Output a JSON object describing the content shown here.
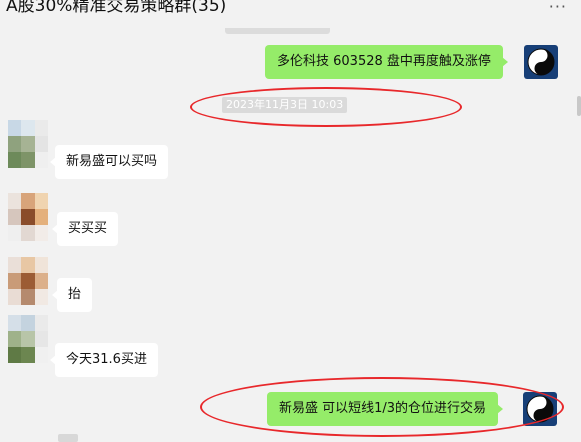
{
  "window": {
    "title": "A股30%精准交易策略群(35)",
    "more_icon": "···"
  },
  "messages": [
    {
      "side": "right",
      "sender": "self",
      "text": "多伦科技 603528  盘中再度触及涨停"
    },
    {
      "type": "timestamp",
      "text": "2023年11月3日 10:03"
    },
    {
      "side": "left",
      "text": "新易盛可以买吗"
    },
    {
      "side": "left",
      "text": "买买买"
    },
    {
      "side": "left",
      "text": "抬"
    },
    {
      "side": "left",
      "text": "今天31.6买进"
    },
    {
      "side": "right",
      "sender": "self",
      "text": "新易盛  可以短线1/3的仓位进行交易"
    }
  ],
  "annotations": {
    "color": "#e8282b",
    "description_icons": [
      "yin-yang-icon"
    ]
  },
  "colors": {
    "self_bubble": "#95ec69",
    "other_bubble": "#ffffff",
    "chat_background": "#f2f2f2",
    "avatar_bg": "#173f77"
  }
}
